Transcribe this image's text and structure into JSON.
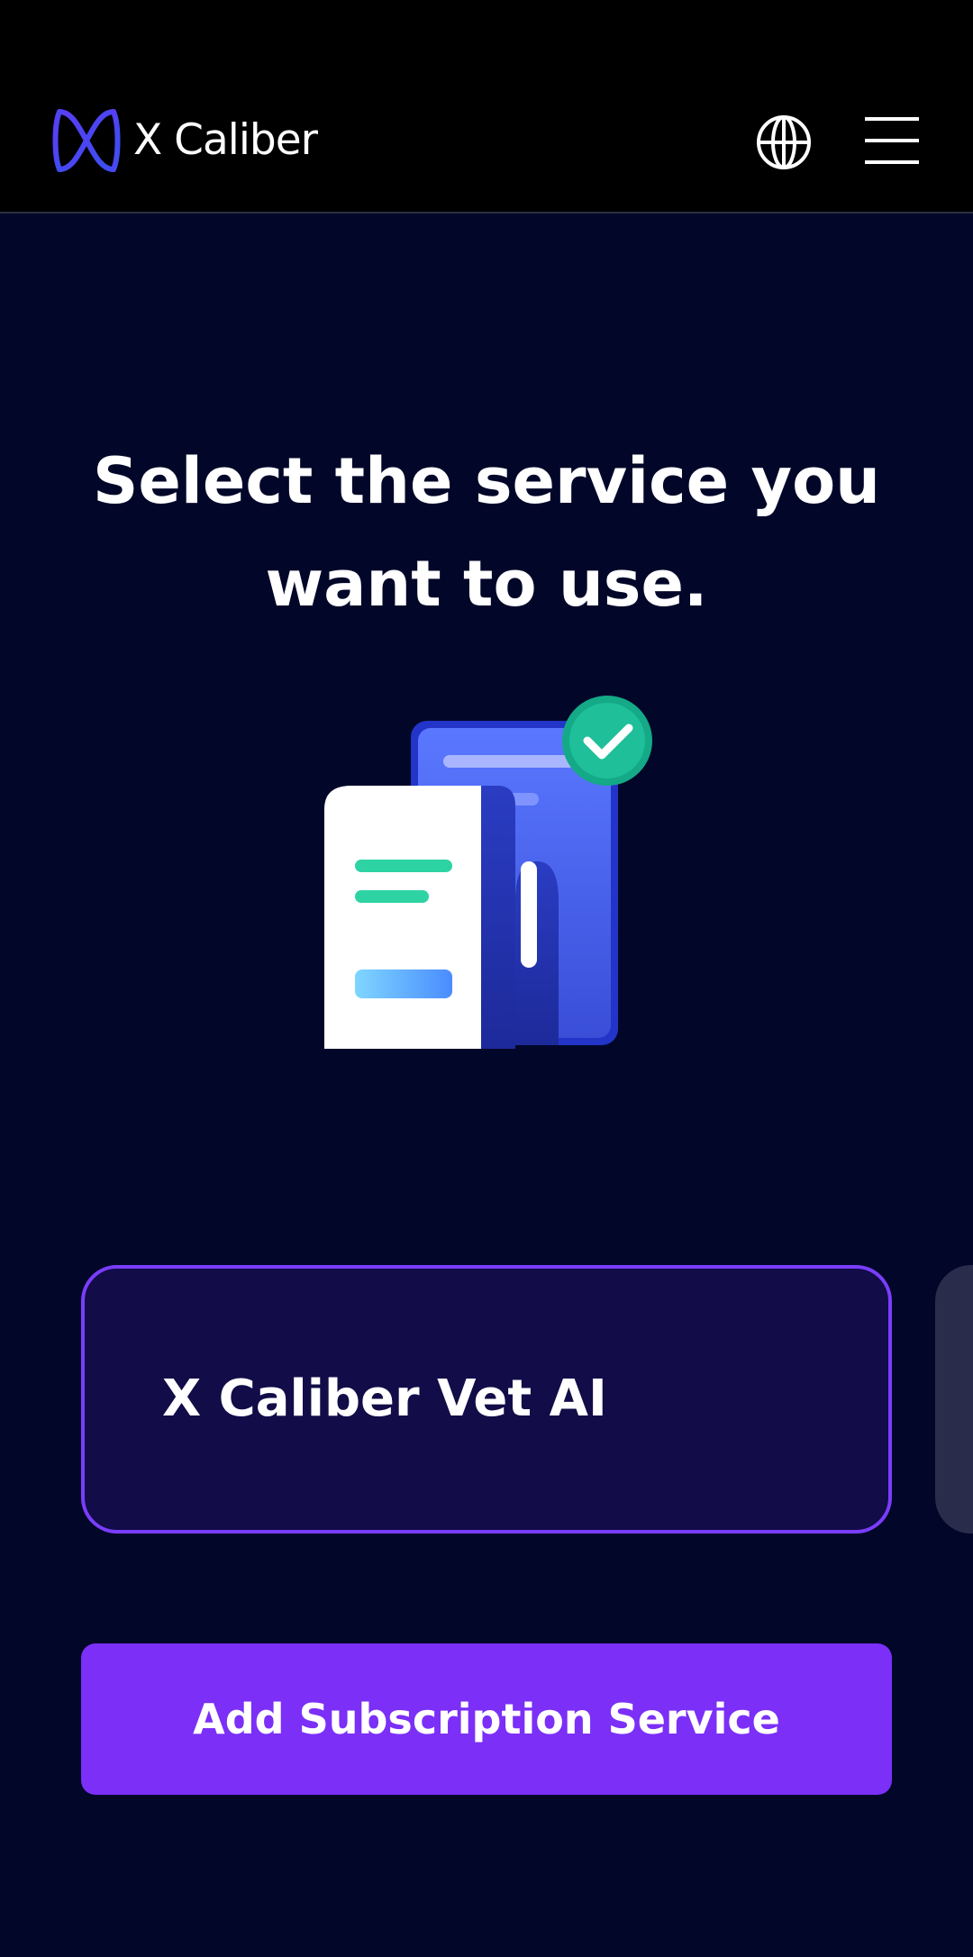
{
  "header": {
    "brand": "X Caliber",
    "icons": {
      "logo": "x-caliber-logo-icon",
      "language": "globe-icon",
      "menu": "hamburger-menu-icon"
    }
  },
  "main": {
    "title": "Select the service you want to use.",
    "illustration_icon": "document-check-illustration",
    "services": [
      {
        "label": "X Caliber Vet AI",
        "selected": true
      }
    ],
    "add_button_label": "Add Subscription Service"
  },
  "colors": {
    "header_bg": "#000000",
    "page_bg": "#020729",
    "accent": "#7b2ff7",
    "card_border": "#7a3dfb",
    "card_bg": "#120c48",
    "check_badge": "#1fbf9a"
  }
}
